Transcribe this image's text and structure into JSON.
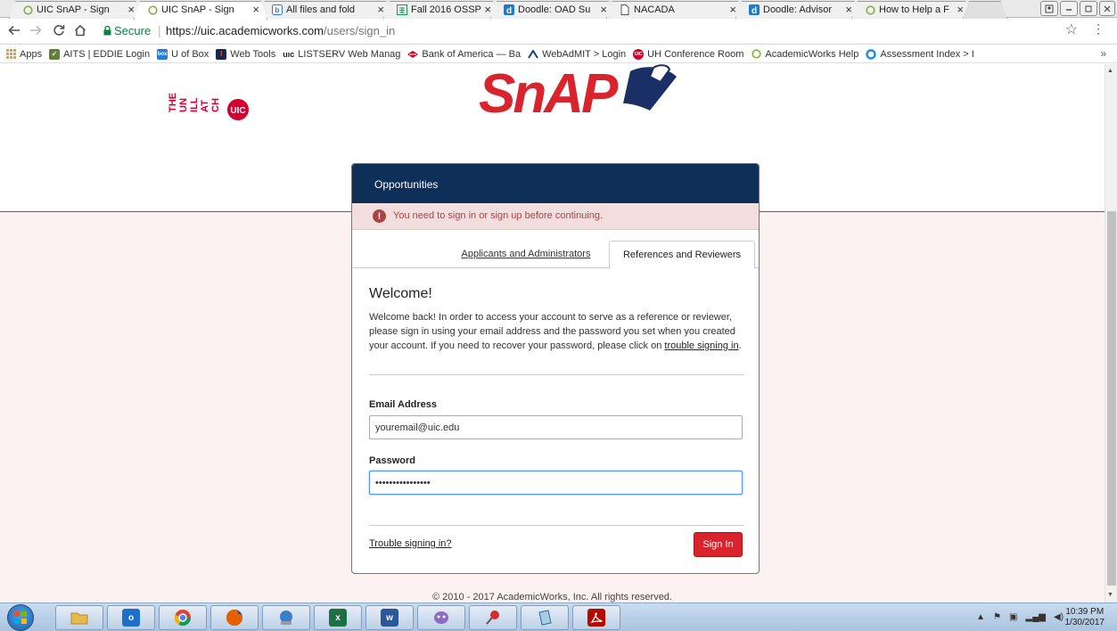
{
  "browser": {
    "tabs": [
      {
        "title": "UIC SnAP - Sign",
        "favicon": "circle-outline-icon",
        "active": false
      },
      {
        "title": "UIC SnAP - Sign",
        "favicon": "circle-outline-icon",
        "active": true
      },
      {
        "title": "All files and fold",
        "favicon": "box-icon",
        "active": false
      },
      {
        "title": "Fall 2016 OSSP",
        "favicon": "sheet-icon",
        "active": false
      },
      {
        "title": "Doodle: OAD Su",
        "favicon": "doodle-icon",
        "active": false
      },
      {
        "title": "NACADA",
        "favicon": "page-icon",
        "active": false
      },
      {
        "title": "Doodle: Advisor",
        "favicon": "doodle-icon",
        "active": false
      },
      {
        "title": "How to Help a F",
        "favicon": "circle-outline-icon",
        "active": false
      }
    ],
    "close_glyph": "×",
    "address": {
      "secure_label": "Secure",
      "url_host": "https://uic.academicworks.com",
      "url_path": "/users/sign_in"
    },
    "bookmarks": [
      {
        "label": "Apps",
        "icon": "apps-grid-icon",
        "color": "#e8a22b"
      },
      {
        "label": "AITS | EDDIE Login",
        "icon": "aits-icon",
        "color": "#5f7f3a"
      },
      {
        "label": "U of Box",
        "icon": "box-icon",
        "color": "#2b7bd6"
      },
      {
        "label": "Web Tools",
        "icon": "illinois-icon",
        "color": "#13294b"
      },
      {
        "label": "LISTSERV Web Manag",
        "icon": "uic-icon",
        "color": "#222222"
      },
      {
        "label": "Bank of America — Ba",
        "icon": "bofa-icon",
        "color": "#d4001a"
      },
      {
        "label": "WebAdMIT > Login",
        "icon": "webadmit-icon",
        "color": "#1c3f94"
      },
      {
        "label": "UH Conference Room",
        "icon": "uic-circle-icon",
        "color": "#d50032"
      },
      {
        "label": "AcademicWorks Help",
        "icon": "circle-outline-icon",
        "color": "#7cb342"
      },
      {
        "label": "Assessment Index > I",
        "icon": "ring-icon",
        "color": "#1e88e5"
      }
    ],
    "more_glyph": "»"
  },
  "page": {
    "logo_uic_text": "UIC",
    "logo_uic_letters": [
      "THE",
      "UN",
      "ILL",
      "AT",
      "CH"
    ],
    "logo_snap_text": "SnAP",
    "card": {
      "header": "Opportunities",
      "alert": "You need to sign in or sign up before continuing.",
      "tabs": [
        {
          "label": "Applicants and Administrators",
          "active": false
        },
        {
          "label": "References and Reviewers",
          "active": true
        }
      ],
      "welcome_title": "Welcome!",
      "welcome_text_before": "Welcome back! In order to access your account to serve as a reference or reviewer, please sign in using your email address and the password you set when you created your account. If you need to recover your password, please click on ",
      "welcome_link": "trouble signing in",
      "welcome_text_after": ".",
      "email_label": "Email Address",
      "email_value": "youremail@uic.edu",
      "password_label": "Password",
      "password_value": "••••••••••••••••",
      "trouble_link": "Trouble signing in?",
      "signin_label": "Sign In"
    },
    "footer": "© 2010 - 2017 AcademicWorks, Inc. All rights reserved."
  },
  "taskbar": {
    "apps": [
      {
        "name": "explorer",
        "icon": "folder-icon",
        "color": "#e6b94d"
      },
      {
        "name": "outlook",
        "icon": "outlook-icon",
        "color": "#1e6fc7"
      },
      {
        "name": "chrome",
        "icon": "chrome-icon",
        "color": "#db4437"
      },
      {
        "name": "firefox",
        "icon": "firefox-icon",
        "color": "#e66000"
      },
      {
        "name": "network",
        "icon": "network-icon",
        "color": "#3b7fc4"
      },
      {
        "name": "excel",
        "icon": "excel-icon",
        "color": "#1d7044",
        "glyph": "x"
      },
      {
        "name": "word",
        "icon": "word-icon",
        "color": "#2b579a",
        "glyph": "w"
      },
      {
        "name": "messenger",
        "icon": "messenger-icon",
        "color": "#8d6cc4"
      },
      {
        "name": "pin",
        "icon": "pin-icon",
        "color": "#d32f2f"
      },
      {
        "name": "notepad",
        "icon": "notepad-icon",
        "color": "#6fa8dc"
      },
      {
        "name": "acrobat",
        "icon": "acrobat-icon",
        "color": "#b30b00"
      }
    ],
    "time": "10:39 PM",
    "date": "1/30/2017"
  }
}
